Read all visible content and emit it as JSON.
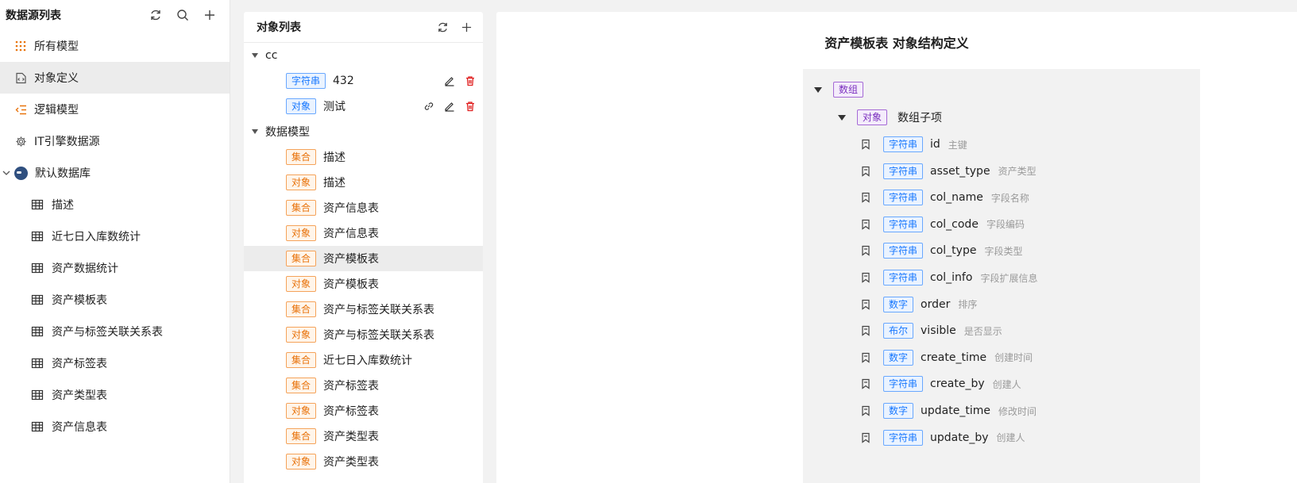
{
  "left": {
    "title": "数据源列表",
    "nav": [
      {
        "label": "所有模型"
      },
      {
        "label": "对象定义"
      },
      {
        "label": "逻辑模型"
      },
      {
        "label": "IT引擎数据源"
      }
    ],
    "db": {
      "label": "默认数据库"
    },
    "tables": [
      "描述",
      "近七日入库数统计",
      "资产数据统计",
      "资产模板表",
      "资产与标签关联关系表",
      "资产标签表",
      "资产类型表",
      "资产信息表"
    ]
  },
  "mid": {
    "title": "对象列表",
    "groups": [
      {
        "label": "cc",
        "items": [
          {
            "tag": "字符串",
            "color": "blue",
            "name": "432"
          },
          {
            "tag": "对象",
            "color": "blue",
            "name": "测试"
          }
        ]
      },
      {
        "label": "数据模型",
        "items": [
          {
            "tag": "集合",
            "color": "orange",
            "name": "描述"
          },
          {
            "tag": "对象",
            "color": "orange",
            "name": "描述"
          },
          {
            "tag": "集合",
            "color": "orange",
            "name": "资产信息表"
          },
          {
            "tag": "对象",
            "color": "orange",
            "name": "资产信息表"
          },
          {
            "tag": "集合",
            "color": "orange",
            "name": "资产模板表"
          },
          {
            "tag": "对象",
            "color": "orange",
            "name": "资产模板表"
          },
          {
            "tag": "集合",
            "color": "orange",
            "name": "资产与标签关联关系表"
          },
          {
            "tag": "对象",
            "color": "orange",
            "name": "资产与标签关联关系表"
          },
          {
            "tag": "集合",
            "color": "orange",
            "name": "近七日入库数统计"
          },
          {
            "tag": "集合",
            "color": "orange",
            "name": "资产标签表"
          },
          {
            "tag": "对象",
            "color": "orange",
            "name": "资产标签表"
          },
          {
            "tag": "集合",
            "color": "orange",
            "name": "资产类型表"
          },
          {
            "tag": "对象",
            "color": "orange",
            "name": "资产类型表"
          }
        ]
      }
    ]
  },
  "right": {
    "title": "资产模板表 对象结构定义",
    "root_tag": "数组",
    "child_tag": "对象",
    "child_name": "数组子项",
    "fields": [
      {
        "tag": "字符串",
        "name": "id",
        "desc": "主键"
      },
      {
        "tag": "字符串",
        "name": "asset_type",
        "desc": "资产类型"
      },
      {
        "tag": "字符串",
        "name": "col_name",
        "desc": "字段名称"
      },
      {
        "tag": "字符串",
        "name": "col_code",
        "desc": "字段编码"
      },
      {
        "tag": "字符串",
        "name": "col_type",
        "desc": "字段类型"
      },
      {
        "tag": "字符串",
        "name": "col_info",
        "desc": "字段扩展信息"
      },
      {
        "tag": "数字",
        "name": "order",
        "desc": "排序"
      },
      {
        "tag": "布尔",
        "name": "visible",
        "desc": "是否显示"
      },
      {
        "tag": "数字",
        "name": "create_time",
        "desc": "创建时间"
      },
      {
        "tag": "字符串",
        "name": "create_by",
        "desc": "创建人"
      },
      {
        "tag": "数字",
        "name": "update_time",
        "desc": "修改时间"
      },
      {
        "tag": "字符串",
        "name": "update_by",
        "desc": "创建人"
      }
    ]
  },
  "colors": {
    "accent_orange": "#e8730c",
    "accent_blue": "#1677ff",
    "accent_purple": "#7b2fbf",
    "delete_red": "#e02020"
  }
}
